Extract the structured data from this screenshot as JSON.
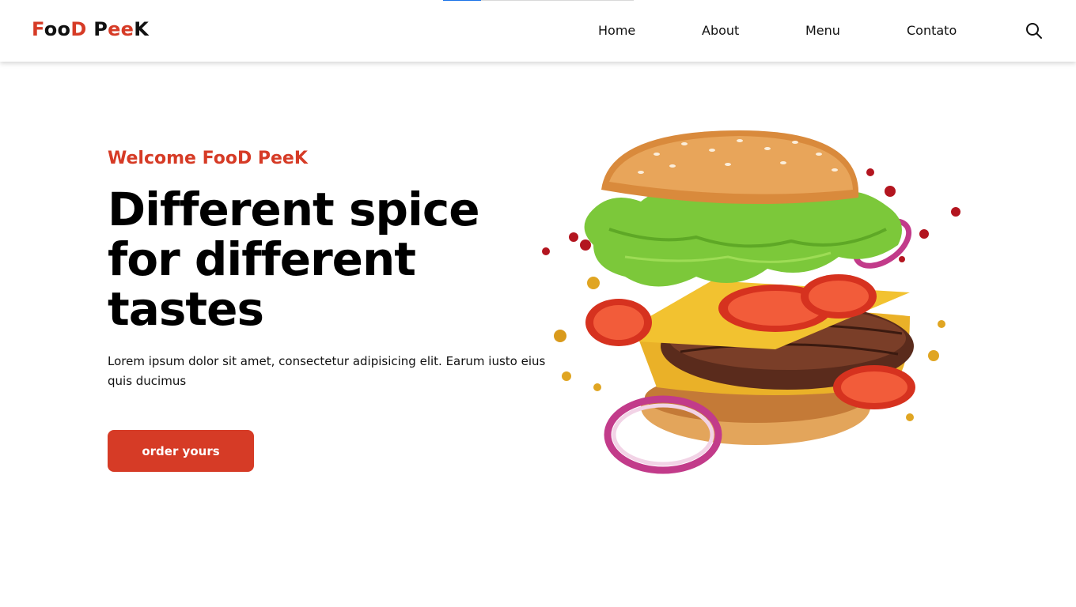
{
  "brand": {
    "logo_parts": [
      "F",
      "oo",
      "D ",
      "P",
      "ee",
      "K"
    ],
    "colors": {
      "accent": "#d63b26",
      "dark": "#111111"
    }
  },
  "page_progress": {
    "fraction": 0.2
  },
  "nav": {
    "items": [
      {
        "label": "Home"
      },
      {
        "label": "About"
      },
      {
        "label": "Menu"
      },
      {
        "label": "Contato"
      }
    ],
    "search_icon": "search-icon"
  },
  "hero": {
    "welcome": "Welcome FooD PeeK",
    "headline": "Different spice for different tastes",
    "description": "Lorem ipsum dolor sit amet, consectetur adipisicing elit. Earum iusto eius quis ducimus",
    "cta_label": "order yours",
    "image_icon": "burger-illustration"
  }
}
